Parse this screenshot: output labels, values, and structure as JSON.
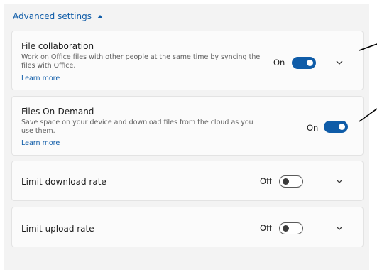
{
  "advanced": {
    "label": "Advanced settings"
  },
  "file_collab": {
    "title": "File collaboration",
    "desc": "Work on Office files with other people at the same time by syncing the files with Office.",
    "learn_more": "Learn more",
    "state": "On"
  },
  "files_on_demand": {
    "title": "Files On-Demand",
    "desc": "Save space on your device and download files from the cloud as you use them.",
    "learn_more": "Learn more",
    "state": "On"
  },
  "download_rate": {
    "title": "Limit download rate",
    "state": "Off"
  },
  "upload_rate": {
    "title": "Limit upload rate",
    "state": "Off"
  },
  "colors": {
    "accent": "#0f5ca8",
    "panel": "#f3f3f3",
    "card": "#fbfbfb"
  }
}
